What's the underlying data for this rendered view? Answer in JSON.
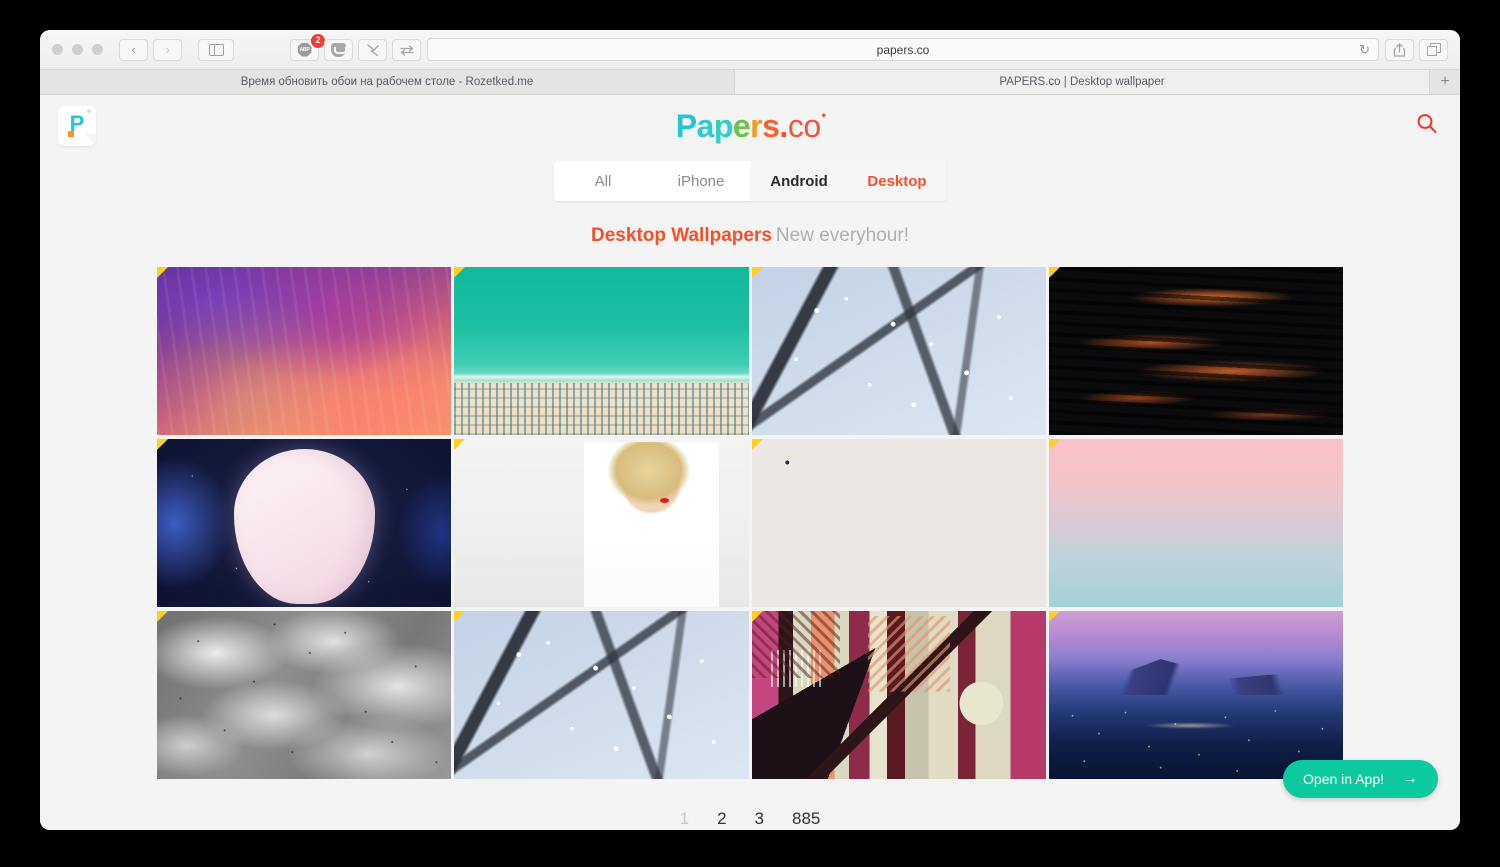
{
  "browser": {
    "traffic_lights": [
      "close",
      "minimize",
      "zoom"
    ],
    "nav": {
      "back": "‹",
      "forward": "›",
      "sidebar": "sidebar-icon"
    },
    "extensions": [
      {
        "name": "adblock-plus",
        "label": "ABP",
        "badge": "2"
      },
      {
        "name": "pocket",
        "label": ""
      },
      {
        "name": "ghostery",
        "label": ""
      },
      {
        "name": "sync",
        "label": ""
      }
    ],
    "address_bar": {
      "url": "papers.co",
      "reload": "↻"
    },
    "right_buttons": [
      {
        "name": "share",
        "label": ""
      },
      {
        "name": "tab-overview",
        "label": ""
      }
    ],
    "tabs": [
      {
        "title": "Время обновить обои на рабочем столе - Rozetked.me",
        "active": false
      },
      {
        "title": "PAPERS.co | Desktop wallpaper",
        "active": true
      }
    ],
    "new_tab_label": "+"
  },
  "site": {
    "logo_badge": {
      "letter": "P",
      "dot": "orange-square"
    },
    "brand": {
      "part1": "P",
      "part2": "a",
      "part3": "p",
      "part4": "e",
      "part5": "r",
      "part6": "s",
      "dot": ".",
      "co": "co",
      "superscript": "•"
    },
    "search_icon": "search-icon",
    "categories": [
      {
        "label": "All",
        "state": "inactive"
      },
      {
        "label": "iPhone",
        "state": "inactive"
      },
      {
        "label": "Android",
        "state": "hover"
      },
      {
        "label": "Desktop",
        "state": "active"
      }
    ],
    "section": {
      "title": "Desktop Wallpapers",
      "subtitle": "New everyhour!"
    },
    "wallpapers": [
      {
        "name": "aurora-sky",
        "art": "art-aurora"
      },
      {
        "name": "beach-aerial",
        "art": "art-beach"
      },
      {
        "name": "blossom-branches",
        "art": "art-blossom"
      },
      {
        "name": "dark-water-fire-reflection",
        "art": "art-water"
      },
      {
        "name": "anime-girl",
        "art": "art-anime"
      },
      {
        "name": "blonde-portrait",
        "art": "art-portrait"
      },
      {
        "name": "water-droplets-macro",
        "art": "art-droplets"
      },
      {
        "name": "pastel-gradient-sky",
        "art": "art-pastel"
      },
      {
        "name": "grey-clouds-texture",
        "art": "art-clouds"
      },
      {
        "name": "blossom-branches-blue",
        "art": "art-blossom"
      },
      {
        "name": "geometric-art-deco",
        "art": "art-geo"
      },
      {
        "name": "city-lights-dusk",
        "art": "art-city"
      }
    ],
    "pagination": [
      {
        "label": "1",
        "current": true
      },
      {
        "label": "2",
        "current": false
      },
      {
        "label": "3",
        "current": false
      },
      {
        "label": "885",
        "current": false
      }
    ],
    "open_in_app": {
      "label": "Open in App!",
      "arrow": "→"
    }
  },
  "colors": {
    "accent_red": "#f4502a",
    "accent_teal": "#22c6d6",
    "button_green": "#0dc9a0",
    "badge_yellow": "#ffd11a",
    "page_bg": "#f4f4f4"
  }
}
